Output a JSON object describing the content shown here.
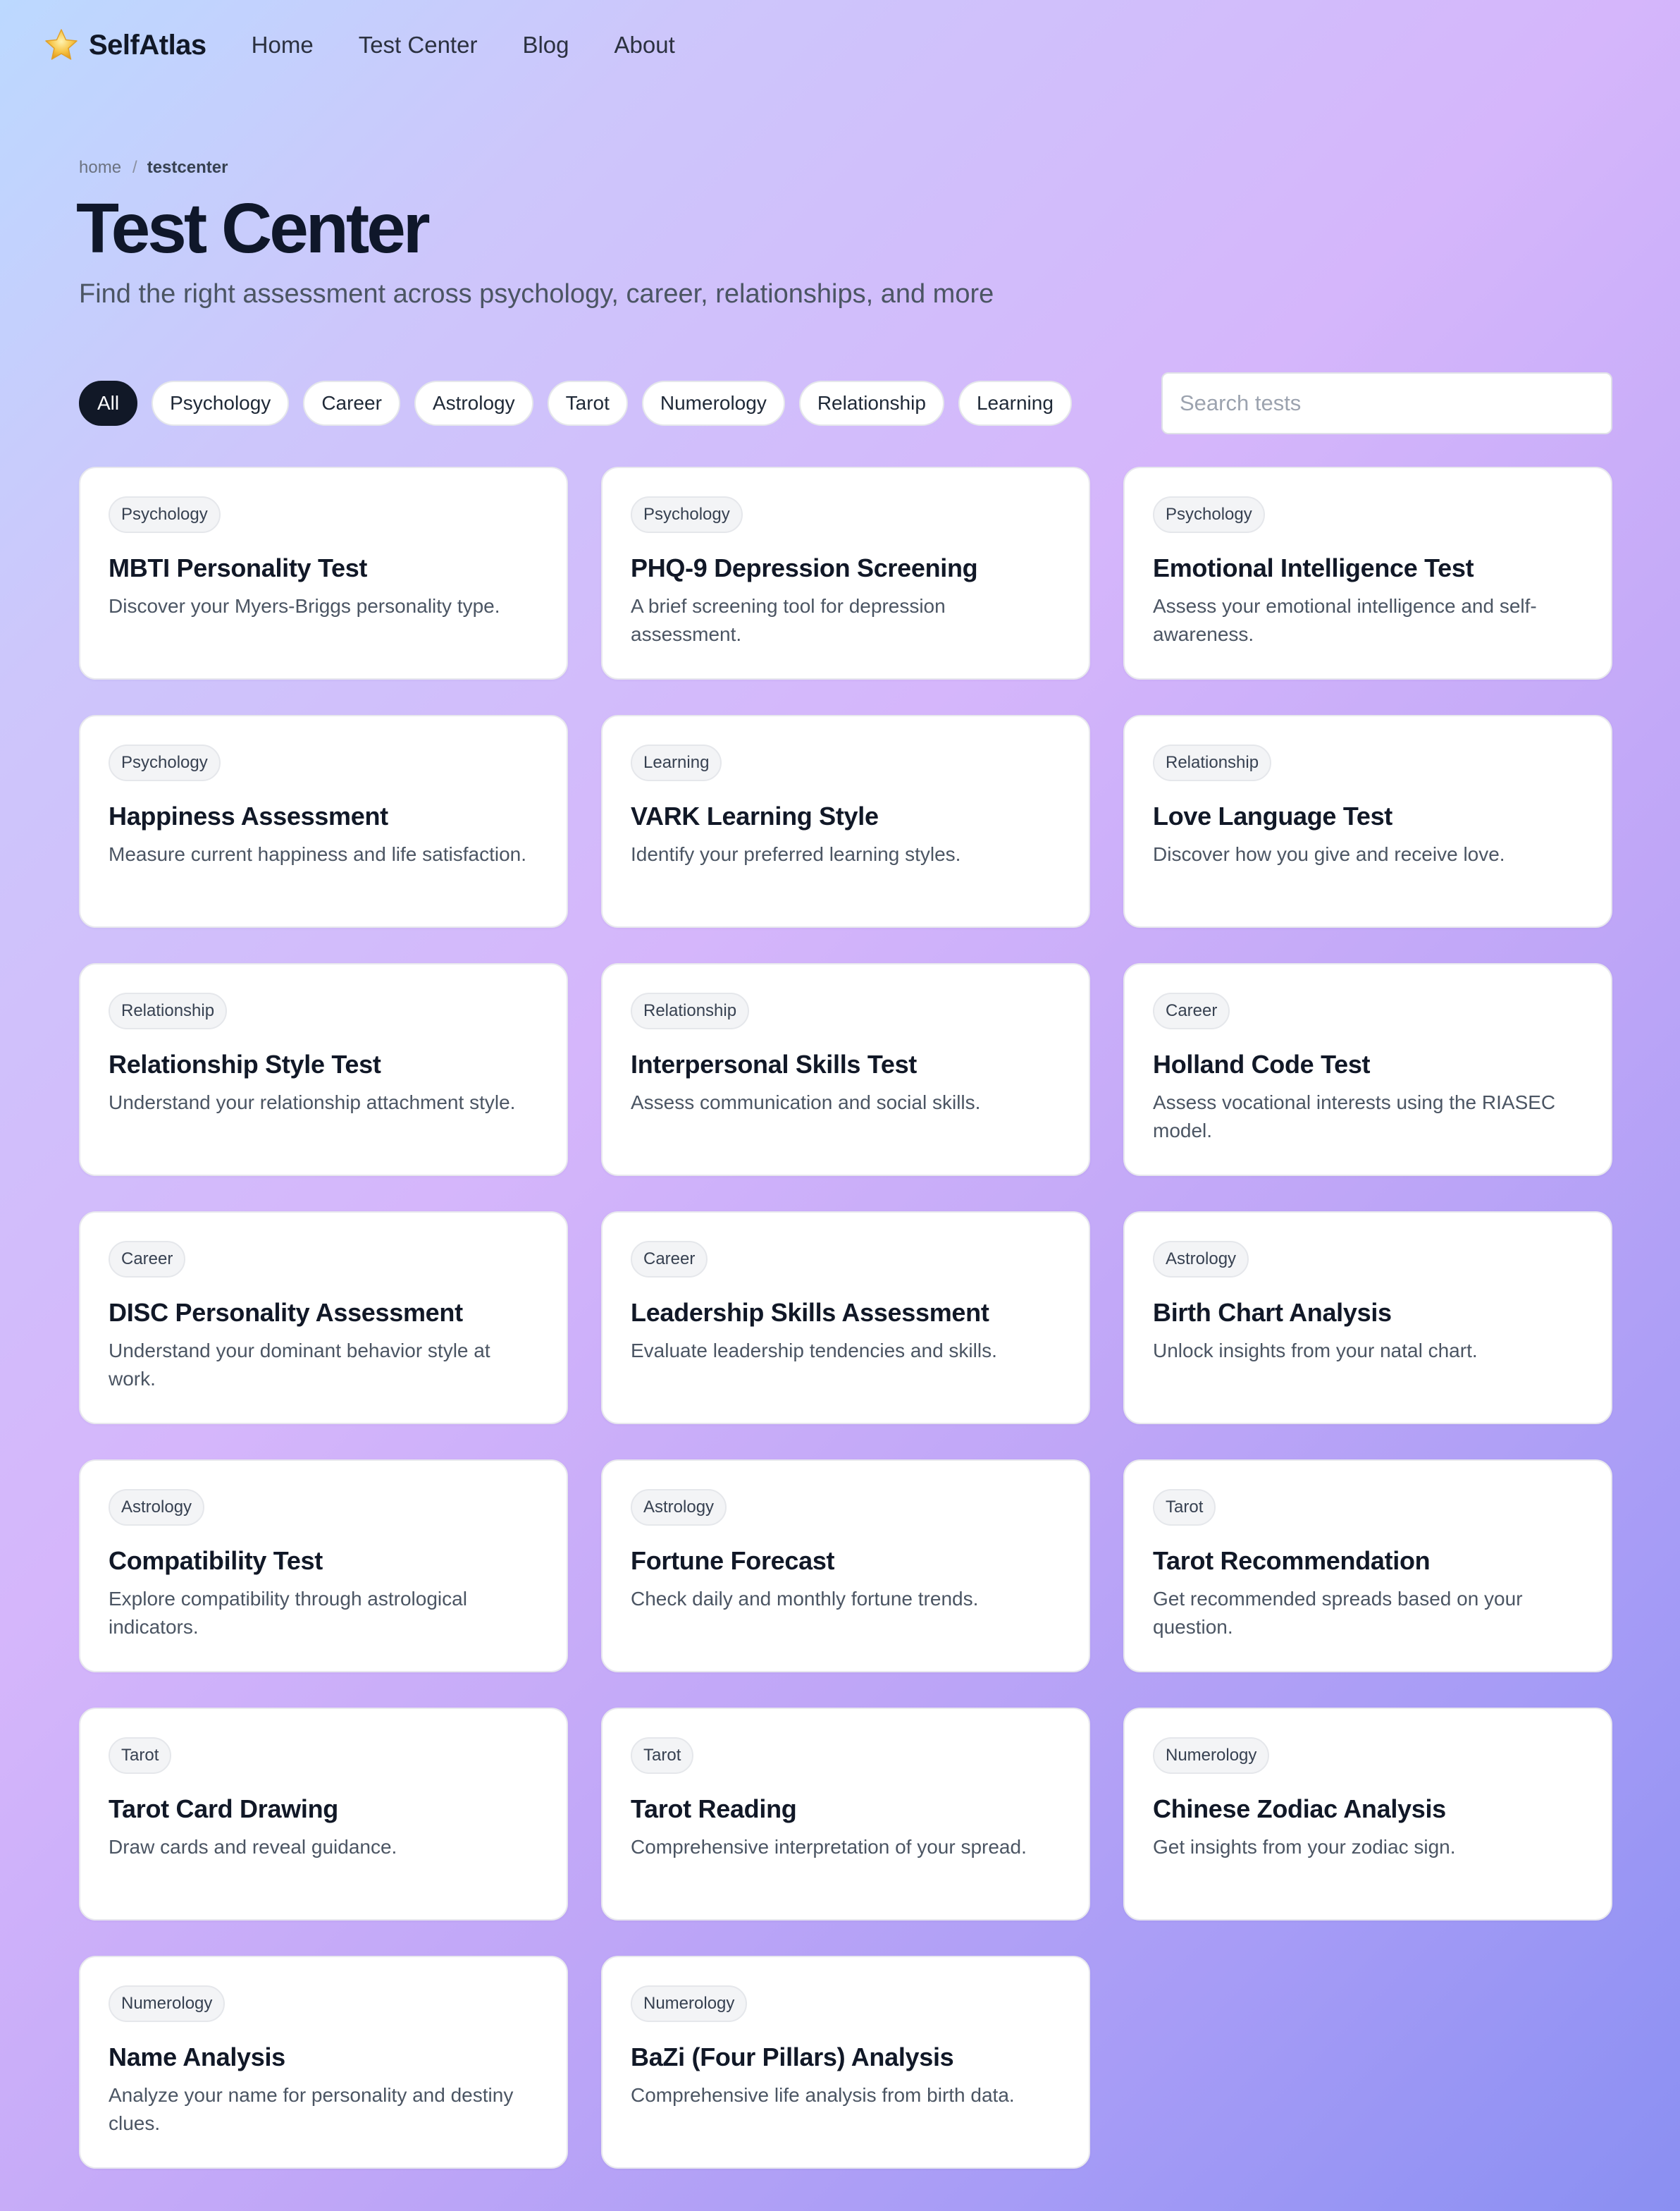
{
  "nav": {
    "brand": "SelfAtlas",
    "brand_icon": "star-icon",
    "links": [
      "Home",
      "Test Center",
      "Blog",
      "About"
    ]
  },
  "breadcrumb": {
    "home": "home",
    "separator": "/",
    "current": "testcenter"
  },
  "header": {
    "title": "Test Center",
    "subtitle": "Find the right assessment across psychology, career, relationships, and more"
  },
  "filters": {
    "active": "All",
    "chips": [
      "All",
      "Psychology",
      "Career",
      "Astrology",
      "Tarot",
      "Numerology",
      "Relationship",
      "Learning"
    ]
  },
  "search": {
    "placeholder": "Search tests",
    "value": ""
  },
  "colors": {
    "accent_dark": "#111827",
    "gradient_start": "#bcd9ff",
    "gradient_mid": "#d5b6fb",
    "gradient_end": "#8a8ff2",
    "brand_star": "#f6c343"
  },
  "tests": [
    {
      "category": "Psychology",
      "title": "MBTI Personality Test",
      "description": "Discover your Myers-Briggs personality type."
    },
    {
      "category": "Psychology",
      "title": "PHQ-9 Depression Screening",
      "description": "A brief screening tool for depression assessment."
    },
    {
      "category": "Psychology",
      "title": "Emotional Intelligence Test",
      "description": "Assess your emotional intelligence and self-awareness."
    },
    {
      "category": "Psychology",
      "title": "Happiness Assessment",
      "description": "Measure current happiness and life satisfaction."
    },
    {
      "category": "Learning",
      "title": "VARK Learning Style",
      "description": "Identify your preferred learning styles."
    },
    {
      "category": "Relationship",
      "title": "Love Language Test",
      "description": "Discover how you give and receive love."
    },
    {
      "category": "Relationship",
      "title": "Relationship Style Test",
      "description": "Understand your relationship attachment style."
    },
    {
      "category": "Relationship",
      "title": "Interpersonal Skills Test",
      "description": "Assess communication and social skills."
    },
    {
      "category": "Career",
      "title": "Holland Code Test",
      "description": "Assess vocational interests using the RIASEC model."
    },
    {
      "category": "Career",
      "title": "DISC Personality Assessment",
      "description": "Understand your dominant behavior style at work."
    },
    {
      "category": "Career",
      "title": "Leadership Skills Assessment",
      "description": "Evaluate leadership tendencies and skills."
    },
    {
      "category": "Astrology",
      "title": "Birth Chart Analysis",
      "description": "Unlock insights from your natal chart."
    },
    {
      "category": "Astrology",
      "title": "Compatibility Test",
      "description": "Explore compatibility through astrological indicators."
    },
    {
      "category": "Astrology",
      "title": "Fortune Forecast",
      "description": "Check daily and monthly fortune trends."
    },
    {
      "category": "Tarot",
      "title": "Tarot Recommendation",
      "description": "Get recommended spreads based on your question."
    },
    {
      "category": "Tarot",
      "title": "Tarot Card Drawing",
      "description": "Draw cards and reveal guidance."
    },
    {
      "category": "Tarot",
      "title": "Tarot Reading",
      "description": "Comprehensive interpretation of your spread."
    },
    {
      "category": "Numerology",
      "title": "Chinese Zodiac Analysis",
      "description": "Get insights from your zodiac sign."
    },
    {
      "category": "Numerology",
      "title": "Name Analysis",
      "description": "Analyze your name for personality and destiny clues."
    },
    {
      "category": "Numerology",
      "title": "BaZi (Four Pillars) Analysis",
      "description": "Comprehensive life analysis from birth data."
    }
  ]
}
